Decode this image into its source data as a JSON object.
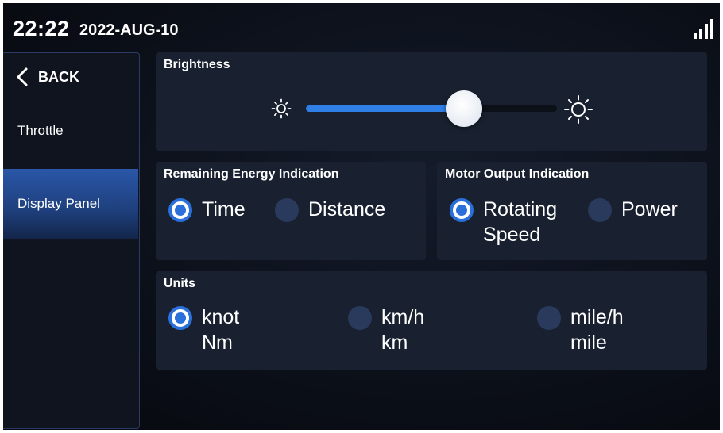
{
  "status_bar": {
    "time": "22:22",
    "date": "2022-AUG-10",
    "signal_icon": "signal-bars-icon"
  },
  "sidebar": {
    "back_label": "BACK",
    "items": [
      {
        "label": "Throttle",
        "active": false
      },
      {
        "label": "Display Panel",
        "active": true
      }
    ]
  },
  "brightness": {
    "title": "Brightness",
    "level": 0.63
  },
  "remaining_energy": {
    "title": "Remaining Energy Indication",
    "options": [
      {
        "label": "Time",
        "selected": true
      },
      {
        "label": "Distance",
        "selected": false
      }
    ]
  },
  "motor_output": {
    "title": "Motor Output Indication",
    "options": [
      {
        "line1": "Rotating",
        "line2": "Speed",
        "selected": true
      },
      {
        "line1": "Power",
        "selected": false
      }
    ]
  },
  "units": {
    "title": "Units",
    "options": [
      {
        "line1": "knot",
        "line2": "Nm",
        "selected": true
      },
      {
        "line1": "km/h",
        "line2": "km",
        "selected": false
      },
      {
        "line1": "mile/h",
        "line2": "mile",
        "selected": false
      }
    ]
  },
  "colors": {
    "accent": "#2b6fdb",
    "card": "#192130",
    "background": "#0b0f18"
  }
}
